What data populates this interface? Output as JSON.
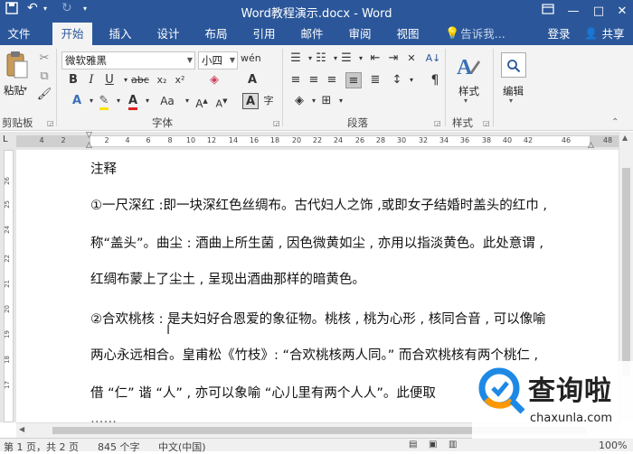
{
  "titlebar": {
    "title": "Word教程演示.docx - Word",
    "undo_icon": "undo-icon",
    "redo_icon": "redo-icon",
    "dropdown_icon": "chevron-down-icon",
    "help_icon": "ribbon-display-icon",
    "minimize": "—",
    "maximize": "□",
    "close": "✕"
  },
  "tabs": [
    {
      "label": "文件"
    },
    {
      "label": "开始"
    },
    {
      "label": "插入"
    },
    {
      "label": "设计"
    },
    {
      "label": "布局"
    },
    {
      "label": "引用"
    },
    {
      "label": "邮件"
    },
    {
      "label": "审阅"
    },
    {
      "label": "视图"
    }
  ],
  "tell_me": "告诉我...",
  "signin": "登录",
  "share": "共享",
  "ribbon": {
    "clipboard": {
      "label": "剪贴板",
      "paste": "粘贴"
    },
    "font": {
      "label": "字体",
      "font_name": "微软雅黑",
      "font_size": "小四"
    },
    "paragraph": {
      "label": "段落"
    },
    "styles": {
      "label": "样式",
      "button": "样式"
    },
    "editing": {
      "label": "编辑",
      "button": "编辑"
    }
  },
  "ruler": {
    "h_ticks": [
      "4",
      "2",
      "",
      "2",
      "4",
      "6",
      "8",
      "10",
      "12",
      "14",
      "16",
      "18",
      "20",
      "22",
      "24",
      "26",
      "28",
      "30",
      "32",
      "34",
      "36",
      "38",
      "40",
      "42",
      "46",
      "48"
    ],
    "v_ticks": [
      "26",
      "25",
      "24",
      "22",
      "21",
      "20",
      "19",
      "18",
      "17"
    ]
  },
  "document": {
    "lines": [
      "注释",
      "①一尺深红 :即一块深红色丝绸布。古代妇人之饰 ,或即女子结婚时盖头的红巾 ,",
      "称“盖头”。曲尘 : 酒曲上所生菌 , 因色微黄如尘 , 亦用以指淡黄色。此处意谓 ,",
      "红绸布蒙上了尘土 , 呈现出酒曲那样的暗黄色。",
      "②合欢桃核 : 是夫妇好合恩爱的象征物。桃核 , 桃为心形 , 核同合音 , 可以像喻",
      "两心永远相合。皇甫松《竹枝》: “合欢桃核两人同。” 而合欢桃核有两个桃仁 ,",
      "借 “仁” 谐 “人” , 亦可以象喻 “心儿里有两个人人”。此便取",
      "……"
    ]
  },
  "status": {
    "page": "第 1 页，共 2 页",
    "words": "845 个字",
    "language": "中文(中国)",
    "zoom": "100%"
  },
  "watermark": {
    "cn": "查询啦",
    "url": "chaxunla.com",
    "accent": "#1e88e5",
    "accent2": "#ff9800"
  },
  "colors": {
    "brand": "#2b579a"
  }
}
